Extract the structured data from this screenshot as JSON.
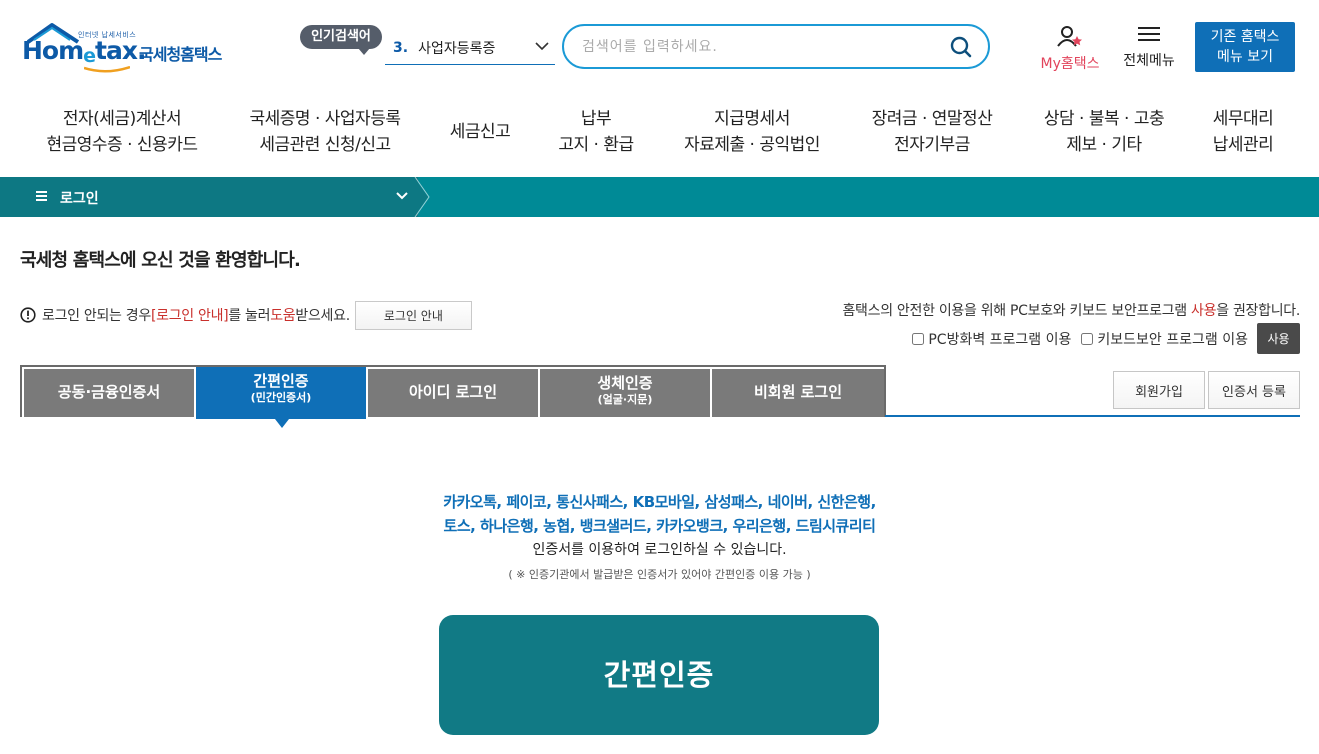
{
  "header": {
    "logo_tiny": "인터넷 납세서비스",
    "logo_word_pre": "Hom",
    "logo_word_e": "e",
    "logo_word_post": "tax.",
    "logo_kr": "국세청홈택스",
    "popular_label": "인기검색어",
    "popular_rank": "3.",
    "popular_keyword": "사업자등록증",
    "search_placeholder": "검색어를 입력하세요.",
    "mytax_label": "My홈택스",
    "allmenu_label": "전체메뉴",
    "oldhome_line1": "기존 홈택스",
    "oldhome_line2": "메뉴 보기"
  },
  "gnb": [
    {
      "line1": "전자(세금)계산서",
      "line2": "현금영수증 · 신용카드"
    },
    {
      "line1": "국세증명 · 사업자등록",
      "line2": "세금관련 신청/신고"
    },
    {
      "line1": "세금신고",
      "line2": ""
    },
    {
      "line1": "납부",
      "line2": "고지 · 환급"
    },
    {
      "line1": "지급명세서",
      "line2": "자료제출 · 공익법인"
    },
    {
      "line1": "장려금 · 연말정산",
      "line2": "전자기부금"
    },
    {
      "line1": "상담 · 불복 · 고충",
      "line2": "제보 · 기타"
    },
    {
      "line1": "세무대리",
      "line2": "납세관리"
    }
  ],
  "location": {
    "current": "로그인"
  },
  "content": {
    "welcome": "국세청 홈택스에 오신 것을 환영합니다.",
    "help_pre": "로그인 안되는 경우 ",
    "help_link": "[로그인 안내]",
    "help_mid": "를 눌러 ",
    "help_red": "도움",
    "help_post": "받으세요.",
    "help_button": "로그인 안내",
    "secure_pre": "홈택스의 안전한 이용을 위해 PC보호와 키보드 보안프로그램 ",
    "secure_red": "사용",
    "secure_post": "을 권장합니다.",
    "opt_firewall": "PC방화벽 프로그램 이용",
    "opt_keyboard": "키보드보안 프로그램 이용",
    "use_button": "사용"
  },
  "tabs": [
    {
      "label": "공동·금융인증서",
      "sub": "",
      "active": false
    },
    {
      "label": "간편인증",
      "sub": "(민간인증서)",
      "active": true
    },
    {
      "label": "아이디 로그인",
      "sub": "",
      "active": false
    },
    {
      "label": "생체인증",
      "sub": "(얼굴·지문)",
      "active": false
    },
    {
      "label": "비회원 로그인",
      "sub": "",
      "active": false
    }
  ],
  "side_buttons": {
    "join": "회원가입",
    "cert_register": "인증서 등록"
  },
  "easy_auth": {
    "providers_line1": "카카오톡, 페이코, 통신사패스, KB모바일, 삼성패스, 네이버, 신한은행,",
    "providers_line2": "토스, 하나은행, 농협, 뱅크샐러드, 카카오뱅크, 우리은행, 드림시큐리티",
    "desc": "인증서를 이용하여 로그인하실 수 있습니다.",
    "note": "( ※ 인증기관에서 발급받은 인증서가 있어야 간편인증 이용 가능 )",
    "button": "간편인증"
  },
  "colors": {
    "brand_blue": "#0f6fb7",
    "teal_bar": "#008a96",
    "teal_button": "#117a85",
    "tab_gray": "#7a7a7a",
    "accent_red": "#c9302c",
    "mytax_pink": "#e2445c"
  },
  "icons": [
    "house-roof-icon",
    "chevron-down-icon",
    "search-icon",
    "user-star-icon",
    "hamburger-icon",
    "exclamation-circle-icon"
  ]
}
